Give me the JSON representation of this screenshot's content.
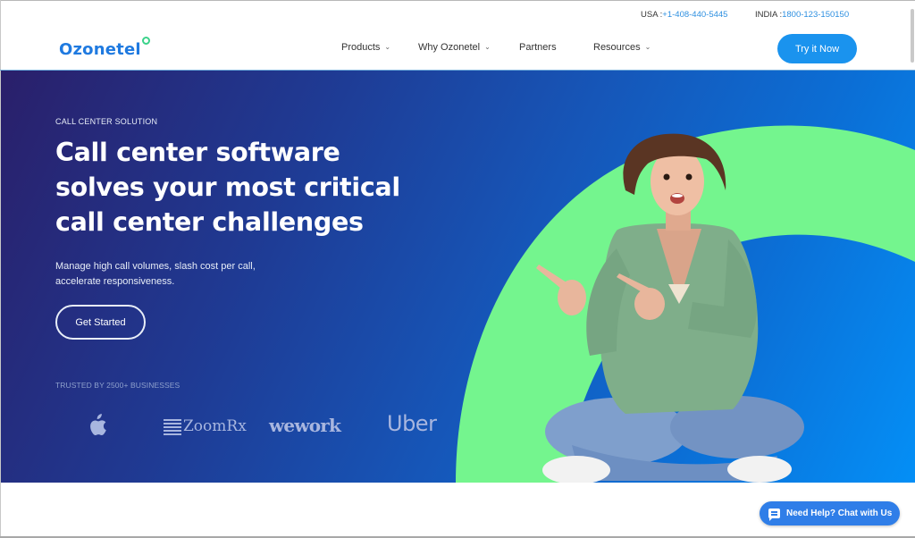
{
  "header": {
    "logo_text": "Ozonetel",
    "contacts": [
      {
        "label": "USA :",
        "phone": "+1-408-440-5445"
      },
      {
        "label": "INDIA :",
        "phone": "1800-123-150150"
      }
    ],
    "nav": [
      {
        "label": "Products",
        "has_dropdown": true
      },
      {
        "label": "Why Ozonetel",
        "has_dropdown": true
      },
      {
        "label": "Partners",
        "has_dropdown": false
      },
      {
        "label": "Resources",
        "has_dropdown": true
      }
    ],
    "chevron": "⌄",
    "cta_label": "Try it Now"
  },
  "hero": {
    "eyebrow": "CALL CENTER SOLUTION",
    "headline_lines": [
      "Call center software",
      "solves your most critical",
      "call center challenges"
    ],
    "subtext_lines": [
      "Manage high call volumes, slash cost per call,",
      "accelerate responsiveness."
    ],
    "cta_label": "Get Started",
    "trusted_label": "TRUSTED BY 2500+ BUSINESSES",
    "brands": [
      {
        "name": "Apple",
        "icon": "apple-icon"
      },
      {
        "name": "ZoomRx"
      },
      {
        "name": "wework"
      },
      {
        "name": "Uber"
      }
    ],
    "image_alt": "Excited woman in green cardigan pointing left"
  },
  "colors": {
    "brand_blue": "#1f7ae0",
    "cta_blue": "#1a93ee",
    "accent_green": "#74f58e",
    "hero_dark": "#2a1f6a",
    "hero_light": "#048ff6",
    "chat_blue": "#2f7ee8"
  },
  "chat": {
    "label": "Need Help? Chat with Us",
    "icon": "chat-bubble-icon"
  }
}
